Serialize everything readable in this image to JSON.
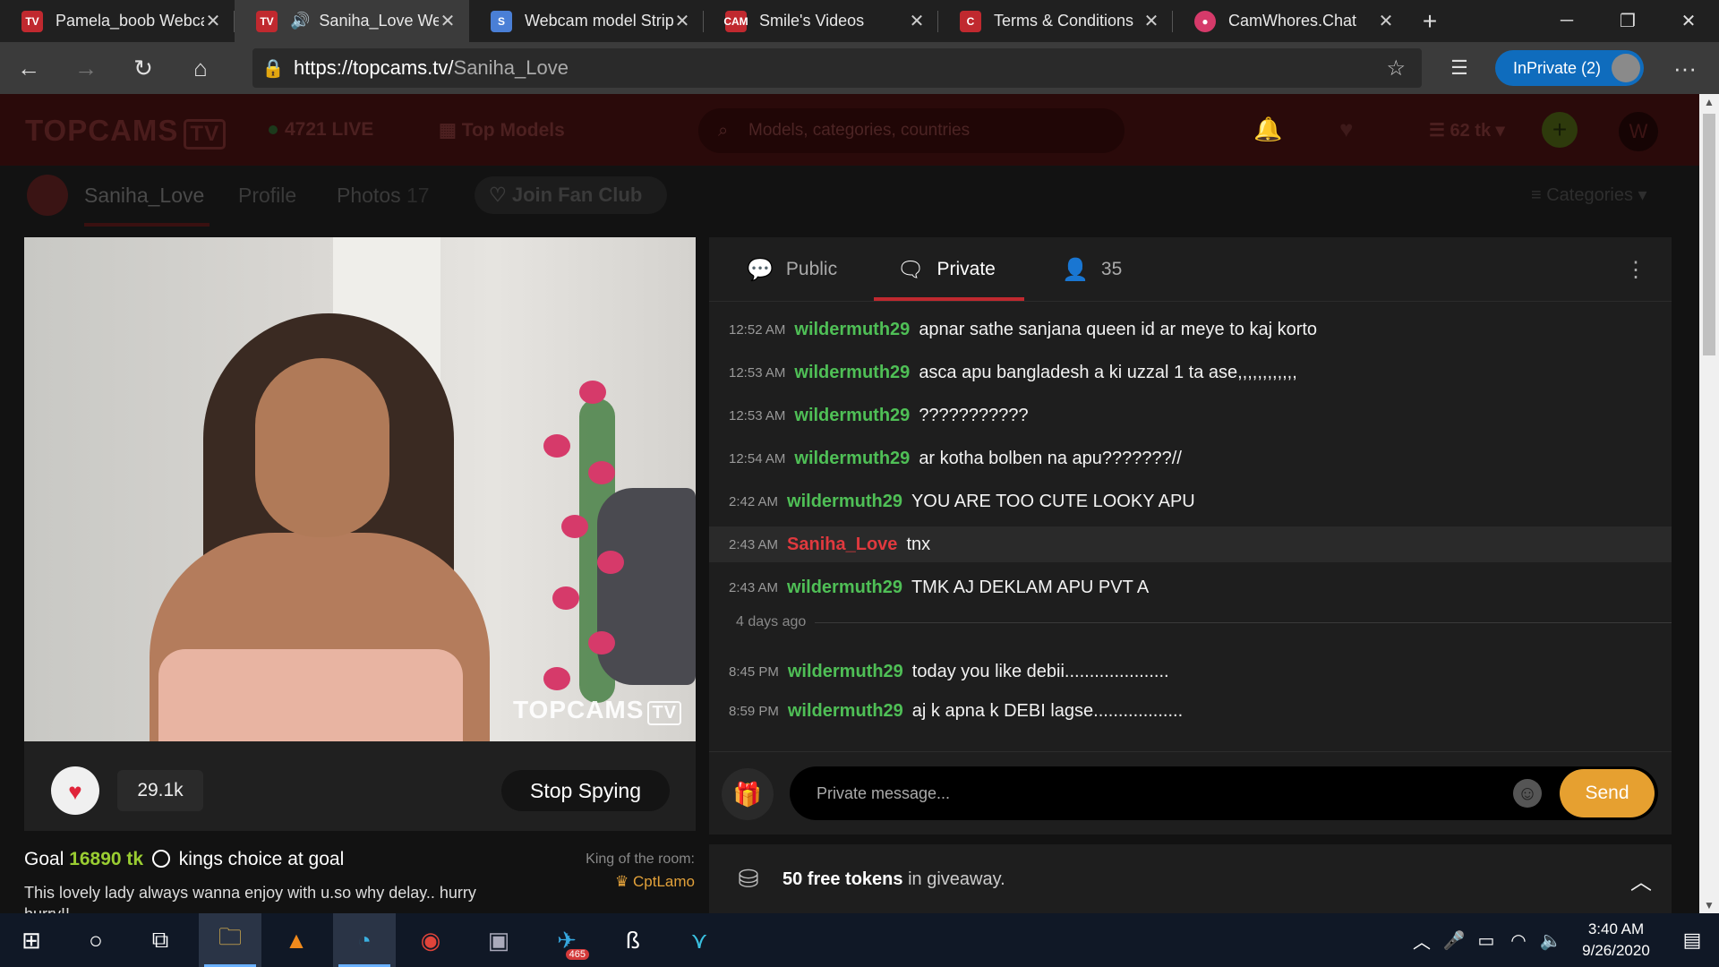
{
  "browser": {
    "tabs": [
      {
        "title": "Pamela_boob Webca",
        "favicon": "tv-icon",
        "color": "#c0292f"
      },
      {
        "title": "Saniha_Love We",
        "favicon": "tv-icon",
        "color": "#c0292f",
        "active": true
      },
      {
        "title": "Webcam model Strip",
        "favicon": "stripchat-icon",
        "color": "#4a7fd6"
      },
      {
        "title": "Smile's Videos",
        "favicon": "camvideos-icon",
        "color": "#c0292f"
      },
      {
        "title": "Terms & Conditions",
        "favicon": "c-icon",
        "color": "#c0292f"
      },
      {
        "title": "CamWhores.Chat",
        "favicon": "camwhores-icon",
        "color": "#d63a6a"
      }
    ],
    "address": {
      "scheme_host": "https://topcams.tv/",
      "path": "Saniha_Love"
    },
    "inprivate_label": "InPrivate (2)",
    "accent": "#0f6cbd"
  },
  "site": {
    "logo": "TOPCAMS",
    "logo_tv": "TV",
    "live_count": "4721 LIVE",
    "top_models": "Top Models",
    "search_placeholder": "Models, categories, countries",
    "tokens": "62 tk",
    "user_initial": "W",
    "model_name": "Saniha_Love",
    "nav": {
      "profile": "Profile",
      "photos": "Photos",
      "photos_count": "17",
      "fan_club": "Join Fan Club",
      "categories": "Categories"
    }
  },
  "video": {
    "watermark": "TOPCAMS",
    "watermark_tv": "TV",
    "likes": "29.1k",
    "stop_spying": "Stop Spying"
  },
  "goal": {
    "label": "Goal",
    "value": "16890 tk",
    "text": "kings choice at goal",
    "description": "This lovely lady always wanna enjoy with u.so why delay.. hurry hurry!!",
    "king_label": "King of the room:",
    "king_name": "CptLamo"
  },
  "chat": {
    "tabs": {
      "public": "Public",
      "private": "Private",
      "viewers": "35"
    },
    "messages": [
      {
        "time": "12:52 AM",
        "user": "wildermuth29",
        "text": "apnar sathe sanjana queen id ar meye to kaj korto"
      },
      {
        "time": "12:53 AM",
        "user": "wildermuth29",
        "text": "asca apu bangladesh a ki uzzal 1 ta ase,,,,,,,,,,,,"
      },
      {
        "time": "12:53 AM",
        "user": "wildermuth29",
        "text": "???????????"
      },
      {
        "time": "12:54 AM",
        "user": "wildermuth29",
        "text": "ar kotha bolben na apu???????//"
      },
      {
        "time": "2:42 AM",
        "user": "wildermuth29",
        "text": "YOU ARE TOO CUTE LOOKY APU"
      },
      {
        "time": "2:43 AM",
        "user": "Saniha_Love",
        "text": "tnx"
      },
      {
        "time": "2:43 AM",
        "user": "wildermuth29",
        "text": "TMK AJ DEKLAM APU PVT A"
      },
      {
        "time": "8:45 PM",
        "user": "wildermuth29",
        "text": "today you like debii....................."
      },
      {
        "time": "8:59 PM",
        "user": "wildermuth29",
        "text": "aj k apna k DEBI lagse.................."
      }
    ],
    "day_separator": "4 days ago",
    "input_placeholder": "Private message...",
    "send_label": "Send",
    "user_color": "#4fbf56",
    "model_color": "#e0393e"
  },
  "giveaway": {
    "bold": "50 free tokens",
    "rest": "in giveaway."
  },
  "taskbar": {
    "telegram_badge": "465",
    "time": "3:40 AM",
    "date": "9/26/2020"
  }
}
